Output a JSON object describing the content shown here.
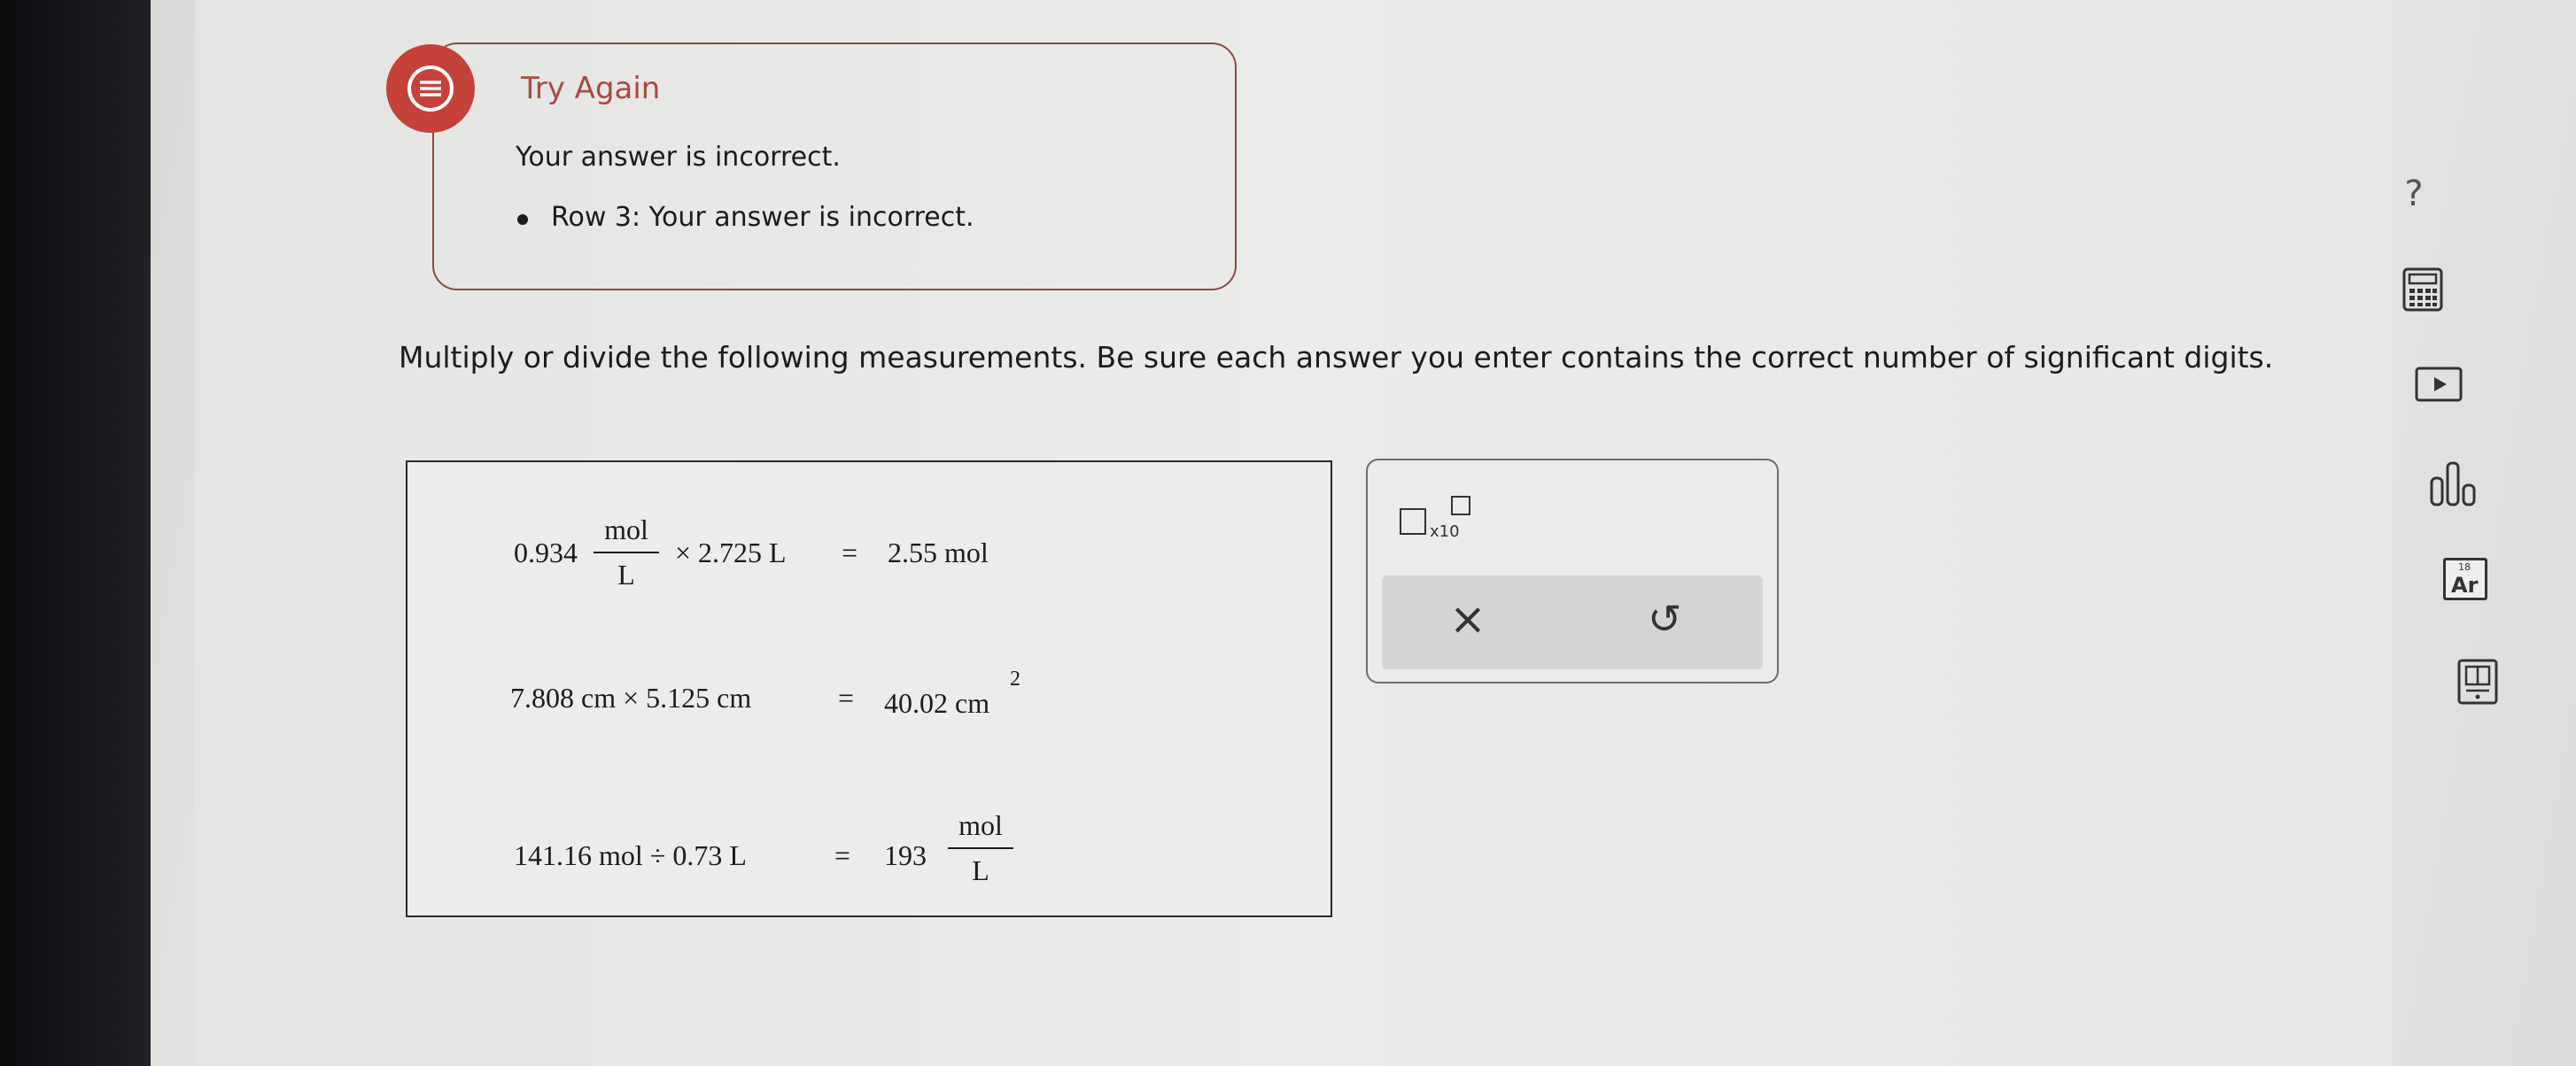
{
  "feedback": {
    "title": "Try Again",
    "message": "Your answer is incorrect.",
    "bullet": "Row 3: Your answer is incorrect."
  },
  "instructions": "Multiply or divide the following measurements. Be sure each answer you enter contains the correct number of significant digits.",
  "rows": [
    {
      "lhs_a": "0.934",
      "lhs_frac_num": "mol",
      "lhs_frac_den": "L",
      "lhs_b": "× 2.725 L",
      "eq": "=",
      "answer": "2.55 mol"
    },
    {
      "lhs": "7.808 cm × 5.125 cm",
      "eq": "=",
      "answer": "40.02 cm",
      "answer_exp": "2"
    },
    {
      "lhs": "141.16 mol ÷ 0.73 L",
      "eq": "=",
      "answer": "193",
      "ans_frac_num": "mol",
      "ans_frac_den": "L"
    }
  ],
  "palette": {
    "sci_label": "x10",
    "clear_symbol": "×",
    "undo_symbol": "↺"
  },
  "toolbar": {
    "help": "?",
    "icons": [
      "calculator-icon",
      "video-icon",
      "chart-icon",
      "periodic-table-icon",
      "reference-book-icon"
    ],
    "periodic_label": "Ar",
    "periodic_num": "18"
  },
  "colors": {
    "accent_red": "#c4423a",
    "title_red": "#a84a42"
  }
}
